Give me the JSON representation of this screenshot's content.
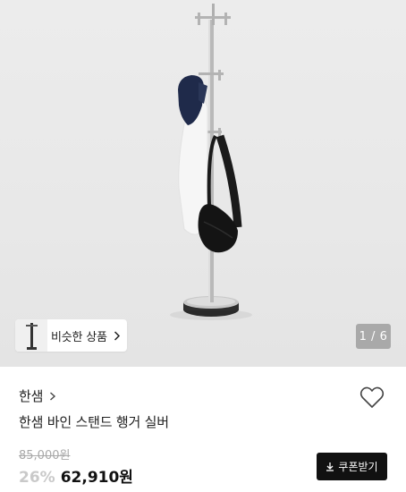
{
  "gallery": {
    "similar_button_label": "비슷한 상품",
    "pager_text": "1 / 6",
    "image_alt": "product-photo-coat-stand"
  },
  "product": {
    "brand": "한샘",
    "name": "한샘 바인 스탠드 행거 실버",
    "original_price": "85,000원",
    "discount_rate": "26%",
    "sale_price": "62,910원",
    "coupon_button_label": "쿠폰받기"
  },
  "icons": {
    "similar_chevron": "chevron-right-icon",
    "brand_chevron": "chevron-right-icon",
    "wishlist": "heart-outline-icon",
    "coupon": "download-icon"
  },
  "colors": {
    "coupon_bg": "#111111",
    "discount": "#c9c9c9",
    "original_price": "#a8a8a8"
  }
}
